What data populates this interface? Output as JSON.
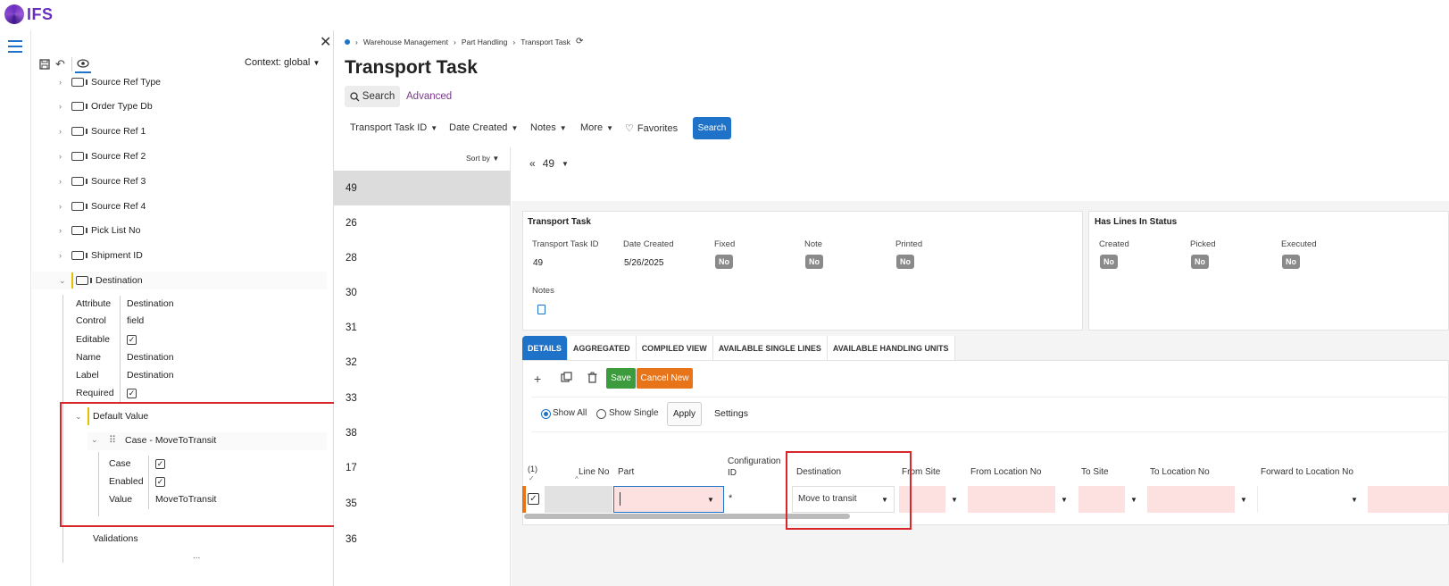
{
  "app": {
    "brand": "IFS",
    "accent": "#1e73c8",
    "highlight_color": "#d9262b"
  },
  "designer": {
    "context_label": "Context: global",
    "tree": [
      {
        "label": "Source Ref Type"
      },
      {
        "label": "Order Type Db"
      },
      {
        "label": "Source Ref 1"
      },
      {
        "label": "Source Ref 2"
      },
      {
        "label": "Source Ref 3"
      },
      {
        "label": "Source Ref 4"
      },
      {
        "label": "Pick List No"
      },
      {
        "label": "Shipment ID"
      },
      {
        "label": "Destination"
      }
    ],
    "props": [
      {
        "label": "Attribute",
        "value": "Destination"
      },
      {
        "label": "Control",
        "value": "field"
      },
      {
        "label": "Editable",
        "value": "✓"
      },
      {
        "label": "Name",
        "value": "Destination"
      },
      {
        "label": "Label",
        "value": "Destination"
      },
      {
        "label": "Required",
        "value": "✓"
      }
    ],
    "default_value_label": "Default Value",
    "case_label": "Case - MoveToTransit",
    "case_props": [
      {
        "label": "Case",
        "value": "✓"
      },
      {
        "label": "Enabled",
        "value": "✓"
      },
      {
        "label": "Value",
        "value": "MoveToTransit"
      }
    ],
    "validations_label": "Validations",
    "more": "..."
  },
  "breadcrumb": [
    "Warehouse Management",
    "Part Handling",
    "Transport Task"
  ],
  "page_title": "Transport Task",
  "search": {
    "label": "Search",
    "advanced": "Advanced"
  },
  "filters": [
    "Transport Task ID",
    "Date Created",
    "Notes",
    "More",
    "Favorites"
  ],
  "search_button": "Search",
  "list": {
    "sort_label": "Sort by",
    "items": [
      "49",
      "26",
      "28",
      "30",
      "31",
      "32",
      "33",
      "38",
      "17",
      "35",
      "36"
    ]
  },
  "record_nav": {
    "current": "49"
  },
  "card1": {
    "title": "Transport Task",
    "fields": [
      {
        "label": "Transport Task ID",
        "value": "49"
      },
      {
        "label": "Date Created",
        "value": "5/26/2025"
      },
      {
        "label": "Fixed",
        "value": "No"
      },
      {
        "label": "Note",
        "value": "No"
      },
      {
        "label": "Printed",
        "value": "No"
      }
    ],
    "notes_label": "Notes"
  },
  "card2": {
    "title": "Has Lines In Status",
    "fields": [
      {
        "label": "Created",
        "value": "No"
      },
      {
        "label": "Picked",
        "value": "No"
      },
      {
        "label": "Executed",
        "value": "No"
      }
    ]
  },
  "tabs": [
    "DETAILS",
    "AGGREGATED",
    "COMPILED VIEW",
    "AVAILABLE SINGLE LINES",
    "AVAILABLE HANDLING UNITS"
  ],
  "toolbar": {
    "save": "Save",
    "cancel": "Cancel New"
  },
  "view": {
    "show_all": "Show All",
    "show_single": "Show Single",
    "apply": "Apply",
    "settings": "Settings"
  },
  "grid": {
    "selected_count": "(1)",
    "columns": [
      "Line No",
      "Part",
      "Configuration ID",
      "Destination",
      "From Site",
      "From Location No",
      "To Site",
      "To Location No",
      "Forward to Location No"
    ],
    "row": {
      "configuration_id": "*",
      "destination": "Move to transit"
    }
  }
}
